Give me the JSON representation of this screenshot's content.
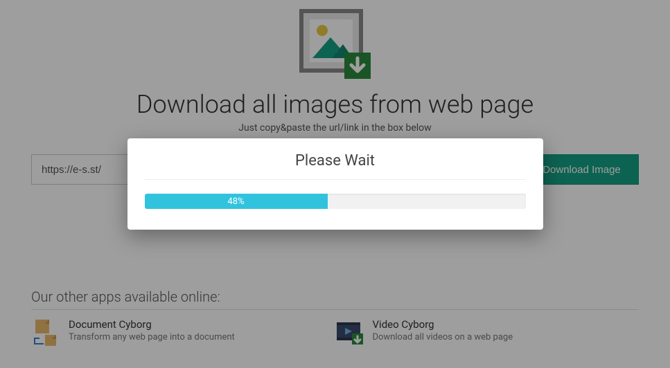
{
  "header": {
    "title": "Download all images from web page",
    "subtitle": "Just copy&paste the url/link in the box below"
  },
  "form": {
    "url_value": "https://e-s.st/",
    "download_button": "Download Image"
  },
  "other_apps": {
    "title": "Our other apps available online:",
    "items": [
      {
        "name": "Document Cyborg",
        "desc": "Transform any web page into a document"
      },
      {
        "name": "Video Cyborg",
        "desc": "Download all videos on a web page"
      }
    ]
  },
  "modal": {
    "title": "Please Wait",
    "progress_percent": 48,
    "progress_label": "48%"
  },
  "colors": {
    "accent": "#16a085",
    "progress": "#31c3dd"
  }
}
